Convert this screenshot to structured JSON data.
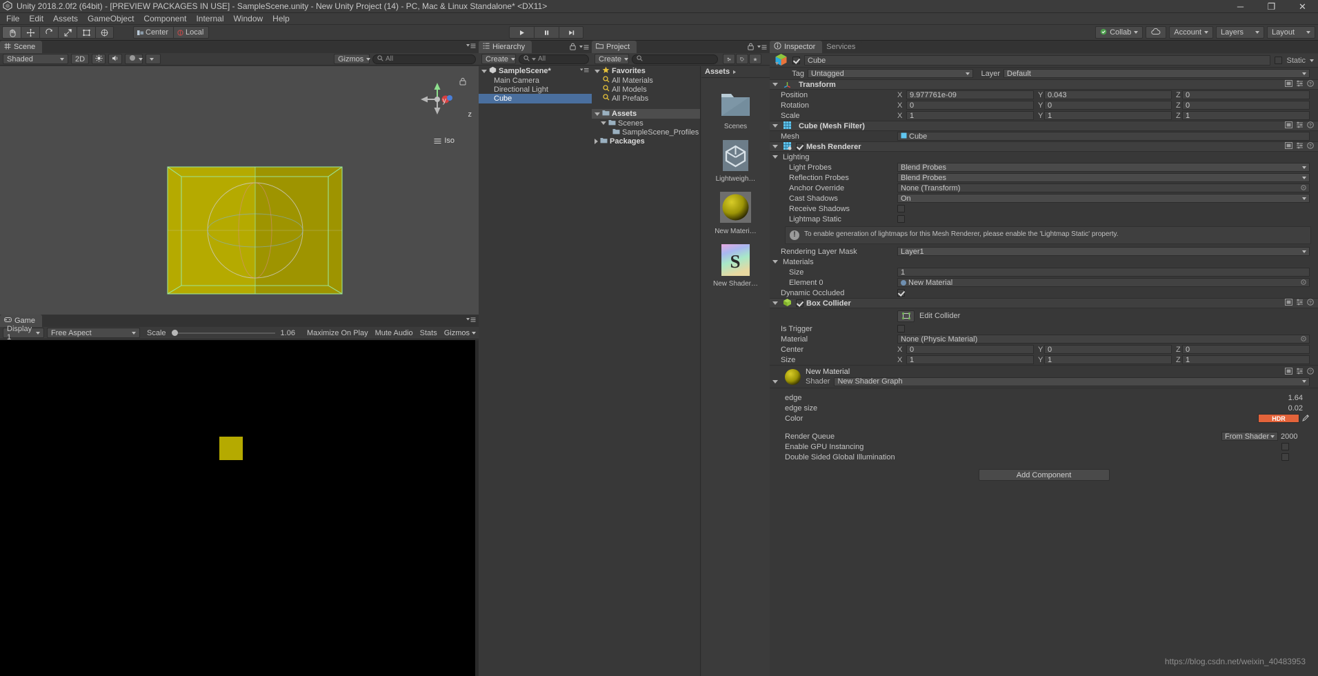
{
  "window": {
    "title": "Unity 2018.2.0f2 (64bit) - [PREVIEW PACKAGES IN USE] - SampleScene.unity - New Unity Project (14) - PC, Mac & Linux Standalone* <DX11>",
    "minimize": "─",
    "maximize": "❐",
    "close": "✕"
  },
  "menubar": {
    "items": [
      "File",
      "Edit",
      "Assets",
      "GameObject",
      "Component",
      "Internal",
      "Window",
      "Help"
    ]
  },
  "toolbar": {
    "tools": [
      "hand-tool",
      "move-tool",
      "rotate-tool",
      "scale-tool",
      "rect-tool",
      "transform-tool"
    ],
    "pivot": "Center",
    "space": "Local",
    "play": "▶",
    "pause": "❙❙",
    "step": "▶❘",
    "collab": "Collab",
    "cloud": "cloud-icon",
    "account": "Account",
    "layers": "Layers",
    "layout": "Layout"
  },
  "scene": {
    "tab": "Scene",
    "shading": "Shaded",
    "two_d": "2D",
    "gizmos": "Gizmos",
    "search_placeholder": "All",
    "axis_y": "y",
    "axis_z": "z",
    "view_mode": "Iso"
  },
  "game": {
    "tab": "Game",
    "display": "Display 1",
    "aspect": "Free Aspect",
    "scale_label": "Scale",
    "scale_value": "1.06",
    "maximize": "Maximize On Play",
    "mute": "Mute Audio",
    "stats": "Stats",
    "gizmos": "Gizmos"
  },
  "hierarchy": {
    "tab": "Hierarchy",
    "create": "Create",
    "search_placeholder": "All",
    "scene_name": "SampleScene*",
    "items": [
      {
        "label": "Main Camera",
        "selected": false
      },
      {
        "label": "Directional Light",
        "selected": false
      },
      {
        "label": "Cube",
        "selected": true
      }
    ]
  },
  "project": {
    "tab": "Project",
    "create": "Create",
    "favorites": "Favorites",
    "favorite_items": [
      "All Materials",
      "All Models",
      "All Prefabs"
    ],
    "assets_root": "Assets",
    "tree": [
      {
        "label": "Scenes",
        "depth": 1
      },
      {
        "label": "SampleScene_Profiles",
        "depth": 2
      }
    ],
    "packages": "Packages",
    "breadcrumb": "Assets",
    "grid_items": [
      {
        "label": "Scenes",
        "kind": "folder"
      },
      {
        "label": "Lightweigh…",
        "kind": "unity-asset"
      },
      {
        "label": "New Materi…",
        "kind": "material"
      },
      {
        "label": "New Shader…",
        "kind": "shader"
      }
    ]
  },
  "inspector": {
    "tab": "Inspector",
    "tab_services": "Services",
    "object_name": "Cube",
    "enabled": true,
    "static_label": "Static",
    "tag_label": "Tag",
    "tag_value": "Untagged",
    "layer_label": "Layer",
    "layer_value": "Default",
    "transform": {
      "title": "Transform",
      "rows": [
        {
          "label": "Position",
          "x": "9.977761e-09",
          "y": "0.043",
          "z": "0"
        },
        {
          "label": "Rotation",
          "x": "0",
          "y": "0",
          "z": "0"
        },
        {
          "label": "Scale",
          "x": "1",
          "y": "1",
          "z": "1"
        }
      ]
    },
    "mesh_filter": {
      "title": "Cube (Mesh Filter)",
      "mesh_label": "Mesh",
      "mesh_value": "Cube"
    },
    "mesh_renderer": {
      "title": "Mesh Renderer",
      "enabled": true,
      "lighting_label": "Lighting",
      "light_probes_label": "Light Probes",
      "light_probes_value": "Blend Probes",
      "reflection_probes_label": "Reflection Probes",
      "reflection_probes_value": "Blend Probes",
      "anchor_override_label": "Anchor Override",
      "anchor_override_value": "None (Transform)",
      "cast_shadows_label": "Cast Shadows",
      "cast_shadows_value": "On",
      "receive_shadows_label": "Receive Shadows",
      "receive_shadows_checked": false,
      "lightmap_static_label": "Lightmap Static",
      "lightmap_static_checked": false,
      "warning": "To enable generation of lightmaps for this Mesh Renderer, please enable the 'Lightmap Static' property.",
      "rendering_layer_mask_label": "Rendering Layer Mask",
      "rendering_layer_mask_value": "Layer1",
      "materials_label": "Materials",
      "size_label": "Size",
      "size_value": "1",
      "element0_label": "Element 0",
      "element0_value": "New Material",
      "dynamic_occluded_label": "Dynamic Occluded",
      "dynamic_occluded_checked": true
    },
    "box_collider": {
      "title": "Box Collider",
      "enabled": true,
      "edit_collider_label": "Edit Collider",
      "is_trigger_label": "Is Trigger",
      "is_trigger_checked": false,
      "material_label": "Material",
      "material_value": "None (Physic Material)",
      "center_label": "Center",
      "center": {
        "x": "0",
        "y": "0",
        "z": "0"
      },
      "size_label": "Size",
      "size": {
        "x": "1",
        "y": "1",
        "z": "1"
      }
    },
    "material": {
      "name": "New Material",
      "shader_label": "Shader",
      "shader_value": "New Shader Graph",
      "props": [
        {
          "label": "edge",
          "value": "1.64"
        },
        {
          "label": "edge size",
          "value": "0.02"
        }
      ],
      "color_label": "Color",
      "color_hdr_badge": "HDR",
      "color_swatch": "#e3633a",
      "render_queue_label": "Render Queue",
      "render_queue_source": "From Shader",
      "render_queue_value": "2000",
      "gpu_instancing_label": "Enable GPU Instancing",
      "gpu_instancing_checked": false,
      "double_sided_gi_label": "Double Sided Global Illumination",
      "double_sided_gi_checked": false
    },
    "add_component": "Add Component"
  },
  "watermark": "https://blog.csdn.net/weixin_40483953",
  "colors": {
    "background": "#383838",
    "panel": "#3b3b3b",
    "selection": "#4a6f9e",
    "cube_yellow": "#b5aa00",
    "accent_green": "#8ee08e"
  }
}
